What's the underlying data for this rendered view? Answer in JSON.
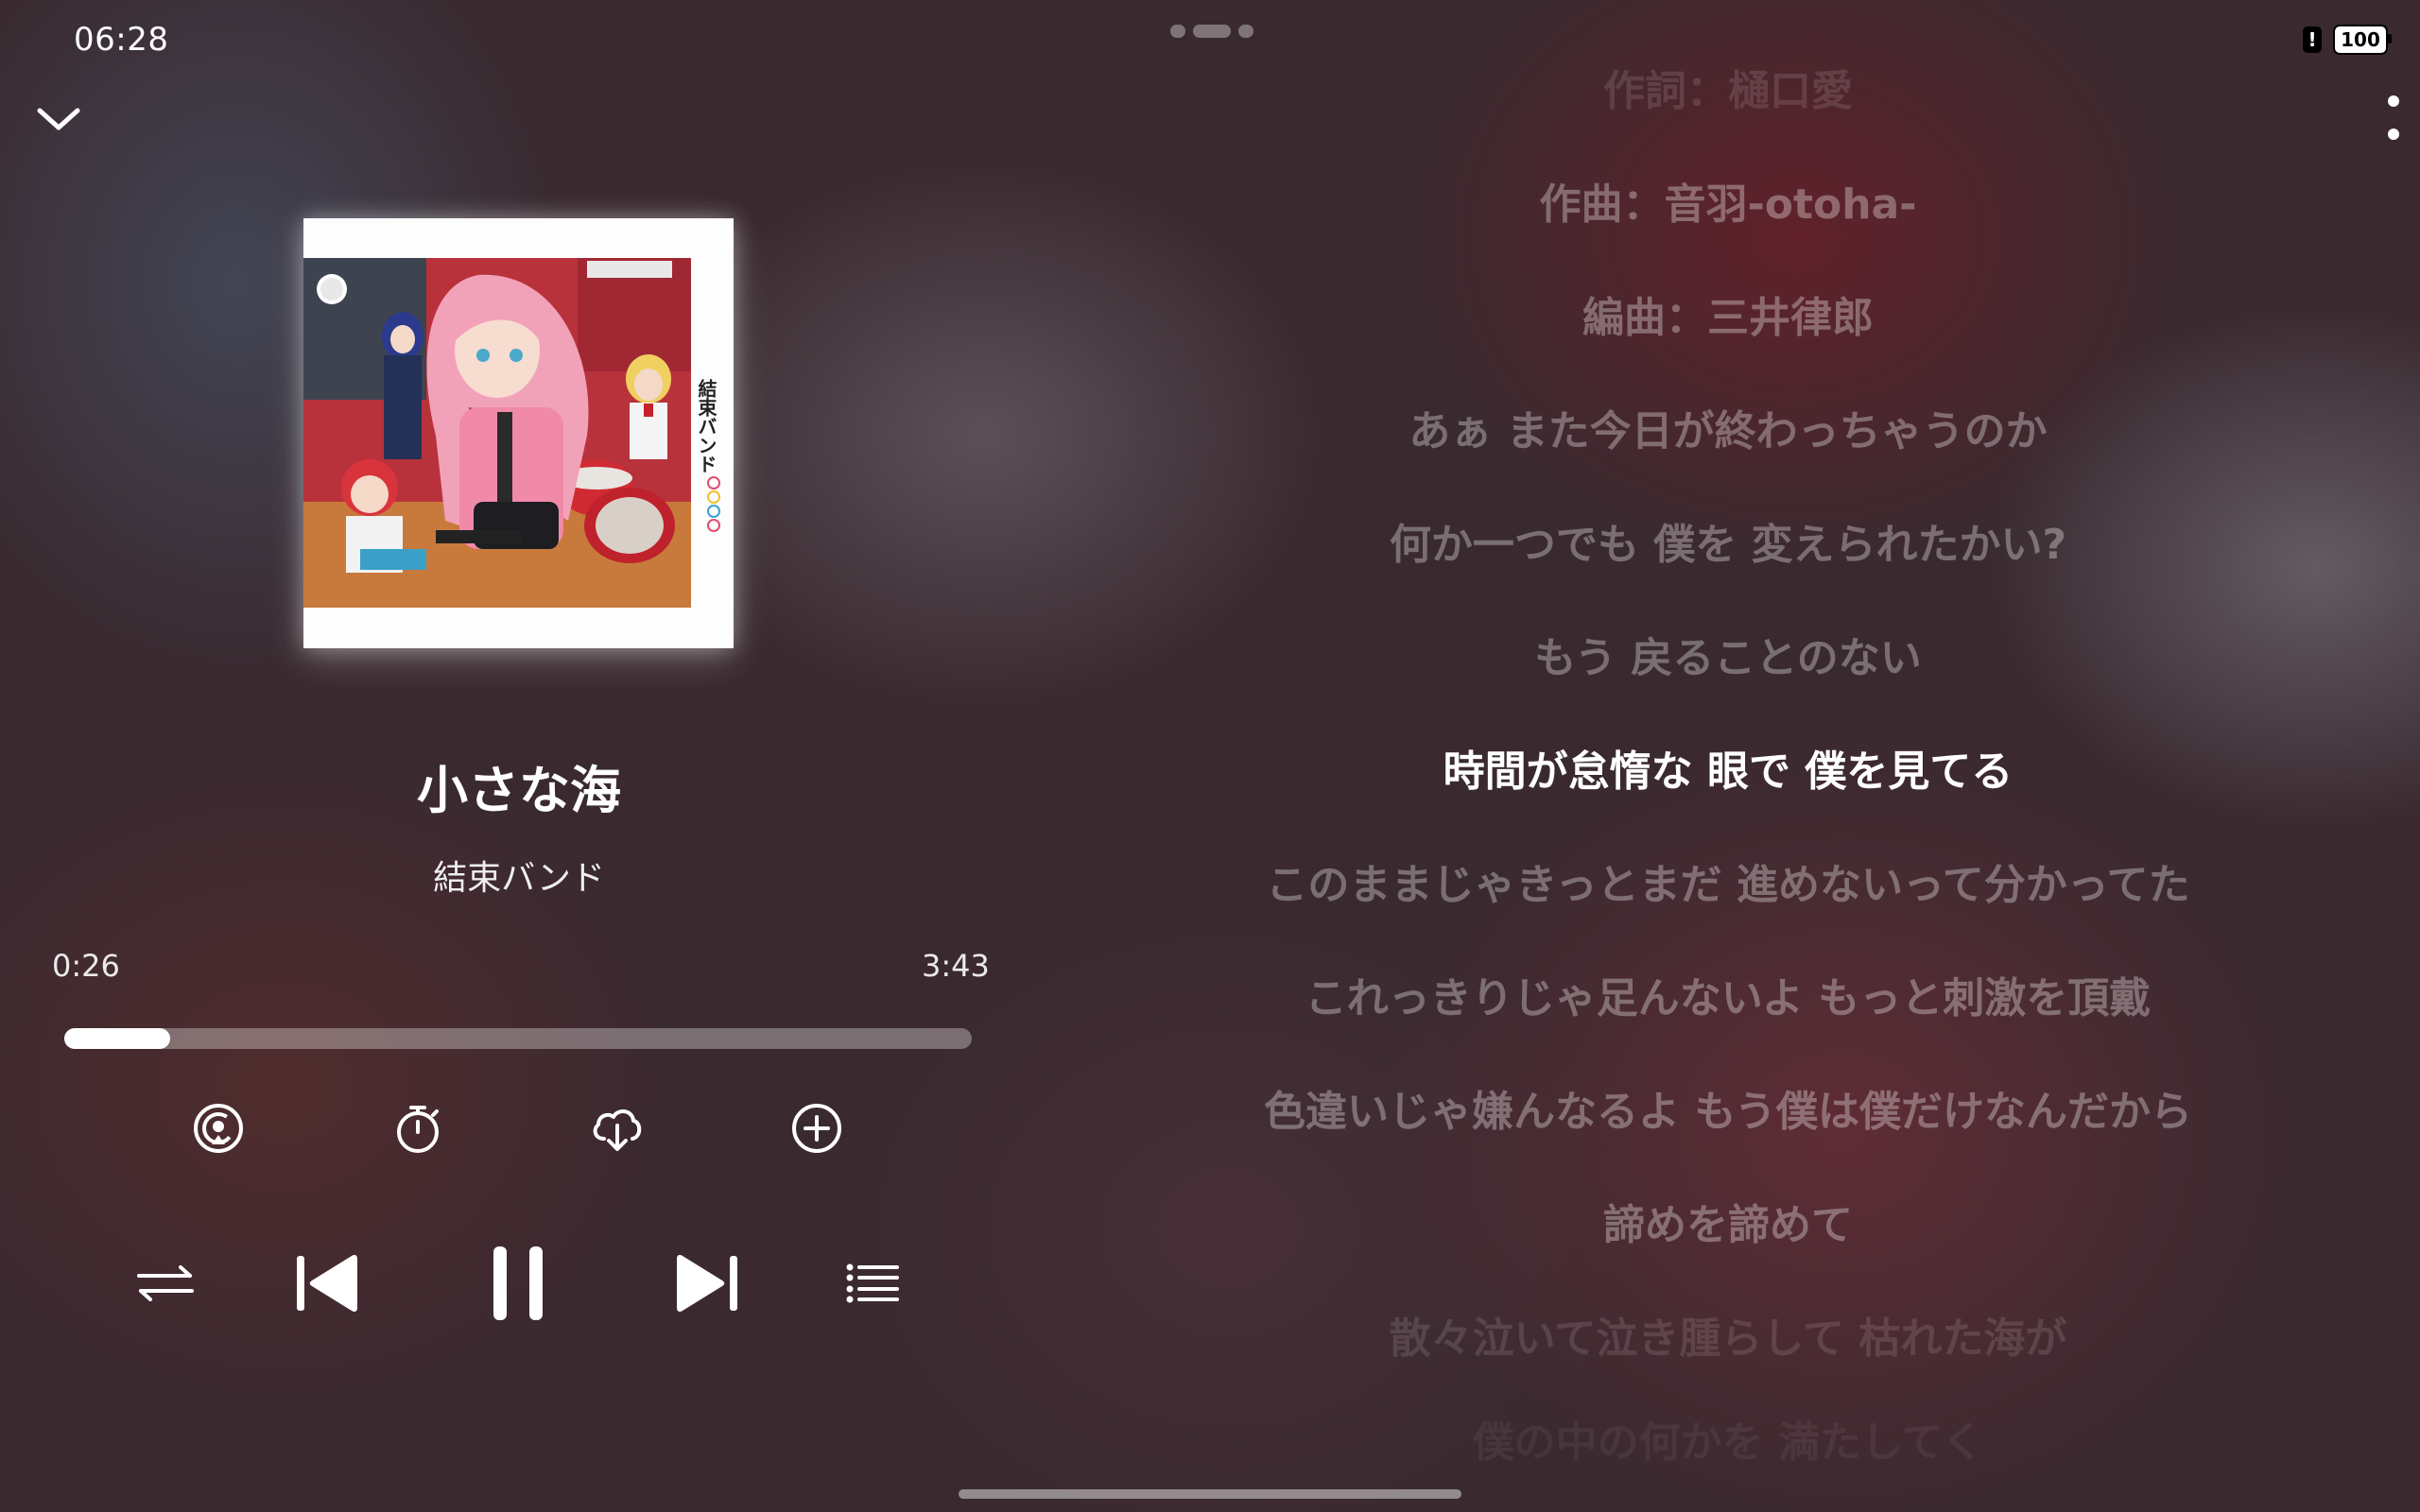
{
  "status_bar": {
    "time": "06:28",
    "battery": "100",
    "alert": "!"
  },
  "player": {
    "title": "小さな海",
    "artist": "結束バンド",
    "elapsed": "0:26",
    "total": "3:43",
    "progress": 0.117
  },
  "album": {
    "spine_text": "結束バンド"
  },
  "icons": {
    "collapse": "chevron-down-icon",
    "more": "more-vertical-icon",
    "cast": "cast-icon",
    "timer": "timer-icon",
    "download": "cloud-download-icon",
    "add": "add-circle-icon",
    "repeat": "repeat-icon",
    "previous": "skip-previous-icon",
    "pause": "pause-icon",
    "next": "skip-next-icon",
    "queue": "queue-list-icon"
  },
  "lyrics": {
    "lines": [
      "作詞：樋口愛",
      "作曲：音羽-otoha-",
      "編曲：三井律郎",
      "あぁ また今日が終わっちゃうのか",
      "何か一つでも 僕を 変えられたかい?",
      "もう 戻ることのない",
      "時間が怠惰な 眼で 僕を見てる",
      "このままじゃきっとまだ 進めないって分かってた",
      "これっきりじゃ足んないよ もっと刺激を頂戴",
      "色違いじゃ嫌んなるよ もう僕は僕だけなんだから",
      "諦めを諦めて",
      "散々泣いて泣き腫らして 枯れた海が",
      "僕の中の何かを 満たしてく"
    ],
    "active_index": 6
  }
}
